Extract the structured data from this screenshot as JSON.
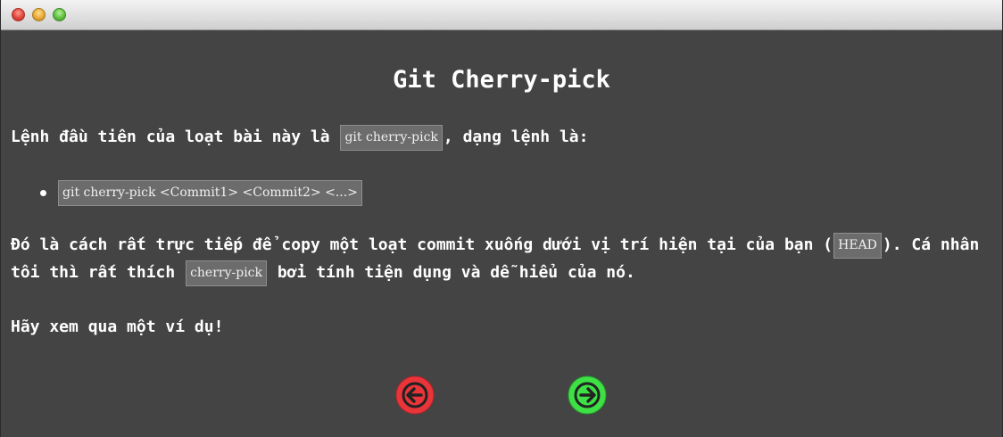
{
  "window": {
    "controls": [
      "close",
      "minimize",
      "zoom"
    ]
  },
  "dialog": {
    "title": "Git Cherry-pick",
    "intro": {
      "before": "Lệnh đầu tiên của loạt bài này là ",
      "code": "git cherry-pick",
      "after": ", dạng lệnh là:"
    },
    "bullets": [
      {
        "code": "git cherry-pick <Commit1> <Commit2> <...>"
      }
    ],
    "description": {
      "line1_before": "Đó là cách rất trực tiếp để copy một loạt commit xuống dưới vị trí hiện tại của bạn (",
      "line1_code": "HEAD",
      "line1_after": "). Cá nhân",
      "line2_before": "tôi thì rất thích ",
      "line2_code": "cherry-pick",
      "line2_after": " bởi tính tiện dụng và dễ hiểu của nó."
    },
    "cta": "Hãy xem qua một ví dụ!",
    "nav": {
      "prev_icon": "arrow-left-icon",
      "next_icon": "arrow-right-icon",
      "prev_color": "#e8353a",
      "next_color": "#3ee045"
    }
  }
}
